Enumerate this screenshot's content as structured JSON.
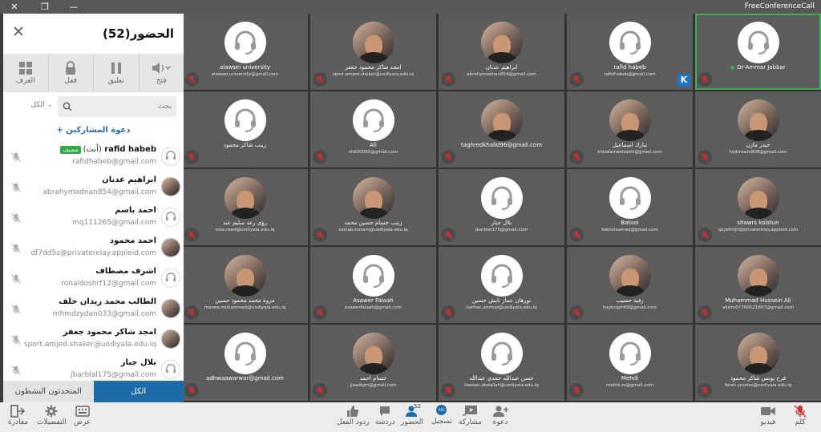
{
  "window": {
    "brand": "FreeConferenceCall"
  },
  "sidebar": {
    "title": "الحضور(52)",
    "tools": [
      {
        "label": "فتح",
        "icon": "speaker-icon"
      },
      {
        "label": "تعليق",
        "icon": "pause-icon"
      },
      {
        "label": "قفل",
        "icon": "lock-icon"
      },
      {
        "label": "الغرف",
        "icon": "grid-icon"
      }
    ],
    "search_placeholder": "بحث",
    "filter_value": "الكل",
    "invite_label": "دعوة المشاركين",
    "participants": [
      {
        "name": "rafid habeb",
        "you": "(أنت)",
        "badge": "مضيف",
        "email": "rafidhabeb@gmail.com",
        "photo": false
      },
      {
        "name": "ابراهيم عدنان",
        "email": "abrahymadnan854@gmail.com",
        "photo": true
      },
      {
        "name": "احمد باسم",
        "email": "mq111265@gmail.com",
        "photo": false
      },
      {
        "name": "احمد محمود",
        "email": "df7dd5z@privaterelay.appleid.com",
        "photo": true
      },
      {
        "name": "اشرف مصطاف",
        "email": "ronaldoshrf12@gmail.com",
        "photo": false
      },
      {
        "name": "الطالب محمد زيدان خلف",
        "email": "mhmdzydan033@gmail.com",
        "photo": true
      },
      {
        "name": "امجد شاكر محمود جعفر",
        "email": "sport.amjed.shaker@uodiyala.edu.iq",
        "photo": true
      },
      {
        "name": "بلال جبار",
        "email": "jbarblal175@gmail.com",
        "photo": false
      }
    ],
    "tabs": {
      "all": "الكل",
      "talkers": "المتحدثون النشطون"
    }
  },
  "tiles": [
    {
      "name": "Dr-Ammar Jabbar",
      "email": "",
      "photo": false,
      "active": true,
      "dot": true
    },
    {
      "name": "rafid habeb",
      "email": "rafidhabeb@gmail.com",
      "photo": false,
      "kbadge": true
    },
    {
      "name": "ابراهيم عدنان",
      "email": "abrahymadnan854@gmail.com",
      "photo": true
    },
    {
      "name": "امجد شاكر محمود جعفر",
      "email": "sport.amjed.shaker@uodiyala.edu.iq",
      "photo": true
    },
    {
      "name": "alawsei university",
      "email": "alawsei.university@gmail.com",
      "photo": false
    },
    {
      "name": "حيدر مازن",
      "email": "hydrmazn808@gmail.com",
      "photo": true
    },
    {
      "name": "تبارك اسماعيل",
      "email": "khlodamaeisashi@gmail.com",
      "photo": true
    },
    {
      "name": "taghredkhalid96@gmail.com",
      "email": "",
      "photo": true
    },
    {
      "name": "Ali",
      "email": "sh930095@gmail.com",
      "photo": false
    },
    {
      "name": "زينب شاكر محمود",
      "email": "",
      "photo": false
    },
    {
      "name": "shawrs kolstun",
      "email": "qzyehttjh@privaterelay.appleid.com",
      "photo": true
    },
    {
      "name": "Batool",
      "email": "batoolaamad@gmail.com",
      "photo": false
    },
    {
      "name": "بلال جبار",
      "email": "jbarblal175@gmail.com",
      "photo": false
    },
    {
      "name": "زينب حسام حسين محمد",
      "email": "zainab.husam@uodiyala.edu.iq",
      "photo": true
    },
    {
      "name": "رؤى رعد سليم عبد",
      "email": "rosa.raed@uodiyala.edu.iq",
      "photo": true
    },
    {
      "name": "Muhammad Hussein Ali",
      "email": "alislm07700521907@gmail.com",
      "photo": true
    },
    {
      "name": "رقية حسيب",
      "email": "haybrqyh69@gmail.com",
      "photo": true
    },
    {
      "name": "نورهان عمار نايش حسين",
      "email": "norhan.ammar@uodiyala.edu.iq",
      "photo": false
    },
    {
      "name": "Asawer Falaah",
      "email": "asawerfalaah@gmail.com",
      "photo": false
    },
    {
      "name": "مروة محمد محمود حسين",
      "email": "marwa.mohammed@uodiyala.edu.iq",
      "photo": true
    },
    {
      "name": "فرح يونس شاكر محمود",
      "email": "farah.younes@uodiyala.edu.iq",
      "photo": true
    },
    {
      "name": "Mehdi",
      "email": "mehdi.zs@gmail.com",
      "photo": false
    },
    {
      "name": "حسن عبدالله حمدي عبدالله",
      "email": "hassan.abdallah@uodiyala.edu.iq",
      "photo": false
    },
    {
      "name": "حسام احمد",
      "email": "jjaadlgm@gmail.com",
      "photo": true
    },
    {
      "name": "adhwaawarwar@gmail.com",
      "email": "",
      "photo": false
    }
  ],
  "bottombar": {
    "left": [
      {
        "label": "مغادرة",
        "icon": "leave-icon"
      },
      {
        "label": "التفضيلات",
        "icon": "gear-icon"
      },
      {
        "label": "عرض",
        "icon": "keyboard-icon"
      }
    ],
    "center": [
      {
        "label": "ردود الفعل",
        "icon": "thumbs-up-icon"
      },
      {
        "label": "دردشة",
        "icon": "chat-icon"
      },
      {
        "label": "الحضور",
        "icon": "attendees-icon",
        "count": "52"
      },
      {
        "label": "تسجيل",
        "icon": "record-icon"
      },
      {
        "label": "مشاركة",
        "icon": "share-screen-icon"
      },
      {
        "label": "دعوة",
        "icon": "invite-icon"
      }
    ],
    "right": [
      {
        "label": "فيديو",
        "icon": "camera-icon"
      },
      {
        "label": "كلم",
        "icon": "mic-muted-icon"
      }
    ]
  },
  "colors": {
    "accent": "#1d6ca8",
    "host_badge": "#2eaa4a",
    "muted_mic": "#d32f2f",
    "active_tile": "#38b24a"
  }
}
